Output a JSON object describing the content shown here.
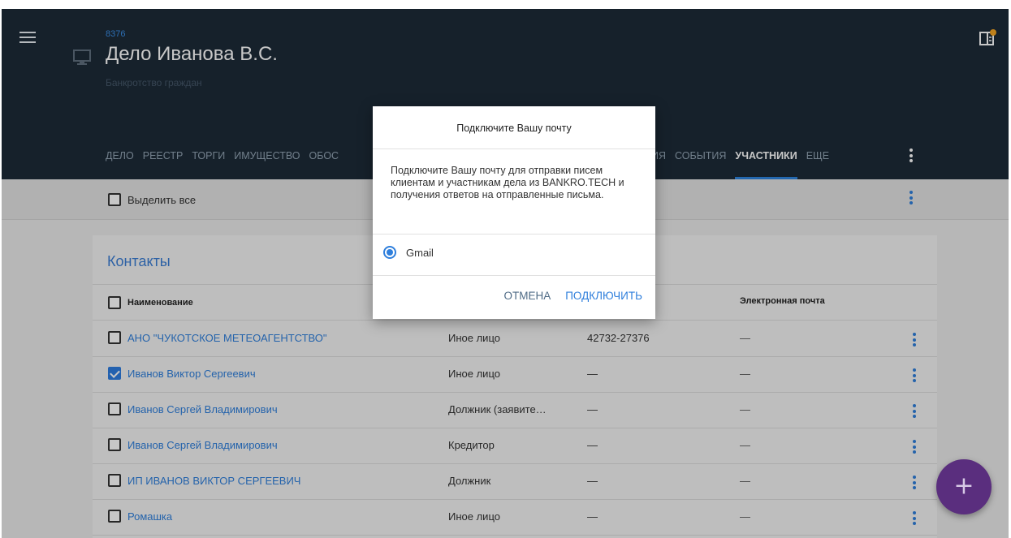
{
  "header": {
    "case_number": "8376",
    "case_title": "Дело Иванова В.С.",
    "case_subtitle": "Банкротство граждан"
  },
  "tabs": {
    "left": [
      "ДЕЛО",
      "РЕЕСТР",
      "ТОРГИ",
      "ИМУЩЕСТВО",
      "ОБОС"
    ],
    "right": [
      {
        "label": "ИЯ",
        "active": false
      },
      {
        "label": "СОБЫТИЯ",
        "active": false
      },
      {
        "label": "УЧАСТНИКИ",
        "active": true
      },
      {
        "label": "ЕЩЕ",
        "active": false
      }
    ]
  },
  "toolbar": {
    "select_all_label": "Выделить все"
  },
  "contacts": {
    "title": "Контакты",
    "columns": {
      "name": "Наименование",
      "email": "Электронная почта"
    },
    "rows": [
      {
        "name": "АНО \"ЧУКОТСКОЕ МЕТЕОАГЕНТСТВО\"",
        "role": "Иное лицо",
        "phone": "42732-27376",
        "email": "—",
        "checked": false
      },
      {
        "name": "Иванов Виктор Сергеевич",
        "role": "Иное лицо",
        "phone": "—",
        "email": "—",
        "checked": true
      },
      {
        "name": "Иванов Сергей Владимирович",
        "role": "Должник (заявите…",
        "phone": "—",
        "email": "—",
        "checked": false
      },
      {
        "name": "Иванов Сергей Владимирович",
        "role": "Кредитор",
        "phone": "—",
        "email": "—",
        "checked": false
      },
      {
        "name": "ИП ИВАНОВ ВИКТОР СЕРГЕЕВИЧ",
        "role": "Должник",
        "phone": "—",
        "email": "—",
        "checked": false
      },
      {
        "name": "Ромашка",
        "role": "Иное лицо",
        "phone": "—",
        "email": "—",
        "checked": false
      }
    ]
  },
  "dialog": {
    "title": "Подключите Вашу почту",
    "body": "Подключите Вашу почту для отправки писем клиентам и участникам дела из BANKRO.TECH и получения ответов на отправленные письма.",
    "option_label": "Gmail",
    "cancel_label": "ОТМЕНА",
    "connect_label": "ПОДКЛЮЧИТЬ"
  },
  "fab": {
    "symbol": "+"
  },
  "colors": {
    "header_bg": "#1d2b38",
    "accent": "#2f7fdc",
    "fab": "#5a2e7e",
    "notification_dot": "#f5a623"
  }
}
